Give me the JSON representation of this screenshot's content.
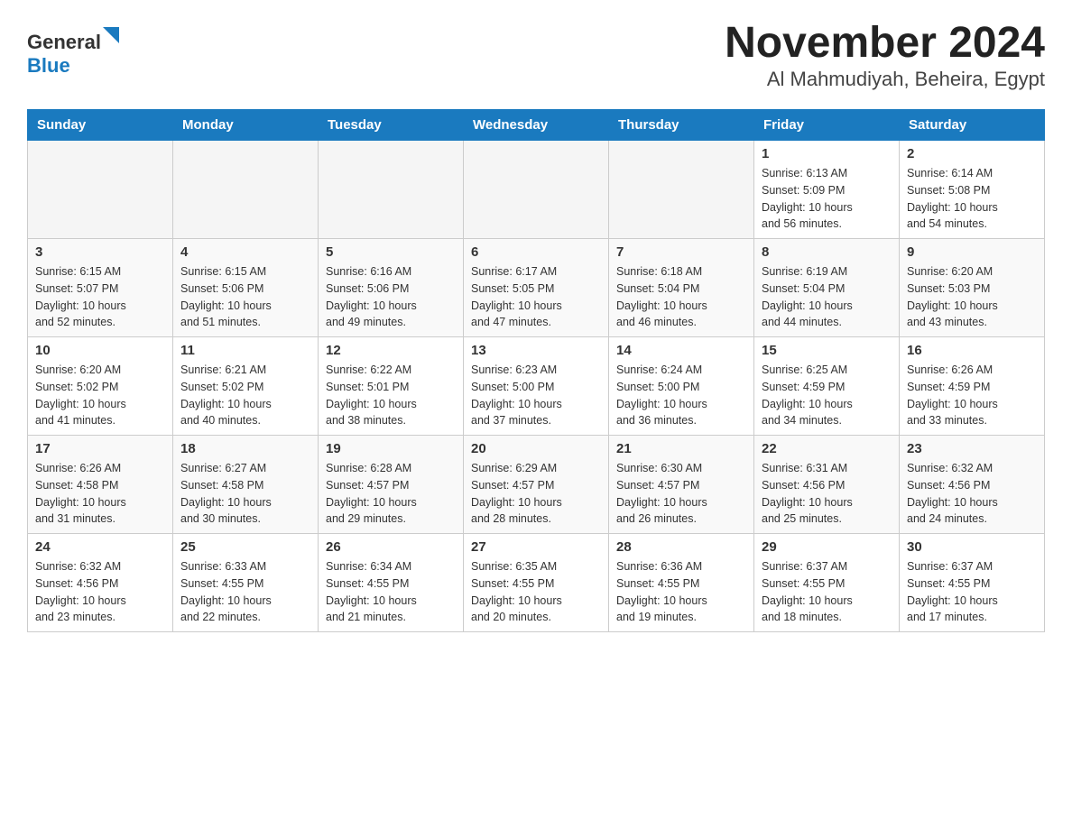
{
  "header": {
    "title": "November 2024",
    "subtitle": "Al Mahmudiyah, Beheira, Egypt",
    "logo_general": "General",
    "logo_blue": "Blue"
  },
  "calendar": {
    "days_of_week": [
      "Sunday",
      "Monday",
      "Tuesday",
      "Wednesday",
      "Thursday",
      "Friday",
      "Saturday"
    ],
    "weeks": [
      [
        {
          "day": "",
          "info": ""
        },
        {
          "day": "",
          "info": ""
        },
        {
          "day": "",
          "info": ""
        },
        {
          "day": "",
          "info": ""
        },
        {
          "day": "",
          "info": ""
        },
        {
          "day": "1",
          "info": "Sunrise: 6:13 AM\nSunset: 5:09 PM\nDaylight: 10 hours\nand 56 minutes."
        },
        {
          "day": "2",
          "info": "Sunrise: 6:14 AM\nSunset: 5:08 PM\nDaylight: 10 hours\nand 54 minutes."
        }
      ],
      [
        {
          "day": "3",
          "info": "Sunrise: 6:15 AM\nSunset: 5:07 PM\nDaylight: 10 hours\nand 52 minutes."
        },
        {
          "day": "4",
          "info": "Sunrise: 6:15 AM\nSunset: 5:06 PM\nDaylight: 10 hours\nand 51 minutes."
        },
        {
          "day": "5",
          "info": "Sunrise: 6:16 AM\nSunset: 5:06 PM\nDaylight: 10 hours\nand 49 minutes."
        },
        {
          "day": "6",
          "info": "Sunrise: 6:17 AM\nSunset: 5:05 PM\nDaylight: 10 hours\nand 47 minutes."
        },
        {
          "day": "7",
          "info": "Sunrise: 6:18 AM\nSunset: 5:04 PM\nDaylight: 10 hours\nand 46 minutes."
        },
        {
          "day": "8",
          "info": "Sunrise: 6:19 AM\nSunset: 5:04 PM\nDaylight: 10 hours\nand 44 minutes."
        },
        {
          "day": "9",
          "info": "Sunrise: 6:20 AM\nSunset: 5:03 PM\nDaylight: 10 hours\nand 43 minutes."
        }
      ],
      [
        {
          "day": "10",
          "info": "Sunrise: 6:20 AM\nSunset: 5:02 PM\nDaylight: 10 hours\nand 41 minutes."
        },
        {
          "day": "11",
          "info": "Sunrise: 6:21 AM\nSunset: 5:02 PM\nDaylight: 10 hours\nand 40 minutes."
        },
        {
          "day": "12",
          "info": "Sunrise: 6:22 AM\nSunset: 5:01 PM\nDaylight: 10 hours\nand 38 minutes."
        },
        {
          "day": "13",
          "info": "Sunrise: 6:23 AM\nSunset: 5:00 PM\nDaylight: 10 hours\nand 37 minutes."
        },
        {
          "day": "14",
          "info": "Sunrise: 6:24 AM\nSunset: 5:00 PM\nDaylight: 10 hours\nand 36 minutes."
        },
        {
          "day": "15",
          "info": "Sunrise: 6:25 AM\nSunset: 4:59 PM\nDaylight: 10 hours\nand 34 minutes."
        },
        {
          "day": "16",
          "info": "Sunrise: 6:26 AM\nSunset: 4:59 PM\nDaylight: 10 hours\nand 33 minutes."
        }
      ],
      [
        {
          "day": "17",
          "info": "Sunrise: 6:26 AM\nSunset: 4:58 PM\nDaylight: 10 hours\nand 31 minutes."
        },
        {
          "day": "18",
          "info": "Sunrise: 6:27 AM\nSunset: 4:58 PM\nDaylight: 10 hours\nand 30 minutes."
        },
        {
          "day": "19",
          "info": "Sunrise: 6:28 AM\nSunset: 4:57 PM\nDaylight: 10 hours\nand 29 minutes."
        },
        {
          "day": "20",
          "info": "Sunrise: 6:29 AM\nSunset: 4:57 PM\nDaylight: 10 hours\nand 28 minutes."
        },
        {
          "day": "21",
          "info": "Sunrise: 6:30 AM\nSunset: 4:57 PM\nDaylight: 10 hours\nand 26 minutes."
        },
        {
          "day": "22",
          "info": "Sunrise: 6:31 AM\nSunset: 4:56 PM\nDaylight: 10 hours\nand 25 minutes."
        },
        {
          "day": "23",
          "info": "Sunrise: 6:32 AM\nSunset: 4:56 PM\nDaylight: 10 hours\nand 24 minutes."
        }
      ],
      [
        {
          "day": "24",
          "info": "Sunrise: 6:32 AM\nSunset: 4:56 PM\nDaylight: 10 hours\nand 23 minutes."
        },
        {
          "day": "25",
          "info": "Sunrise: 6:33 AM\nSunset: 4:55 PM\nDaylight: 10 hours\nand 22 minutes."
        },
        {
          "day": "26",
          "info": "Sunrise: 6:34 AM\nSunset: 4:55 PM\nDaylight: 10 hours\nand 21 minutes."
        },
        {
          "day": "27",
          "info": "Sunrise: 6:35 AM\nSunset: 4:55 PM\nDaylight: 10 hours\nand 20 minutes."
        },
        {
          "day": "28",
          "info": "Sunrise: 6:36 AM\nSunset: 4:55 PM\nDaylight: 10 hours\nand 19 minutes."
        },
        {
          "day": "29",
          "info": "Sunrise: 6:37 AM\nSunset: 4:55 PM\nDaylight: 10 hours\nand 18 minutes."
        },
        {
          "day": "30",
          "info": "Sunrise: 6:37 AM\nSunset: 4:55 PM\nDaylight: 10 hours\nand 17 minutes."
        }
      ]
    ]
  }
}
